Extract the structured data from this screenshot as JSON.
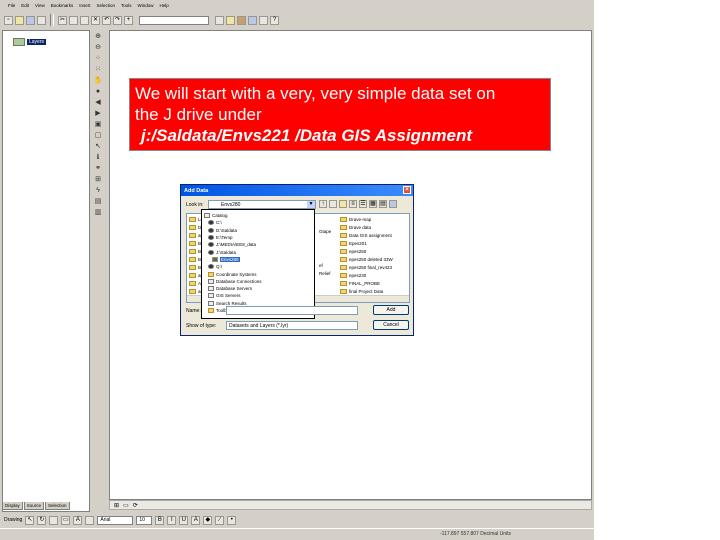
{
  "menu": [
    "File",
    "Edit",
    "View",
    "Bookmarks",
    "Insert",
    "Selection",
    "Tools",
    "Window",
    "Help"
  ],
  "toc": {
    "layer_label": "Layers",
    "tabs": [
      "Display",
      "Source",
      "Selection"
    ]
  },
  "callout": {
    "line1": "We will start with a very, very simple data set on",
    "line2": "the J drive under",
    "line3": "j:/Saldata/Envs221 /Data GIS Assignment"
  },
  "dialog": {
    "title": "Add Data",
    "look_in_label": "Look in:",
    "look_in_value": "Envs280",
    "name_label": "Name:",
    "type_label": "Show of type:",
    "type_value": "Datasets and Layers (*.lyr)",
    "add_button": "Add",
    "cancel_button": "Cancel",
    "list_col1": [
      "Lower",
      "Dr_stee",
      "armo",
      "BO_proje",
      "BO_proje",
      "BO_rus",
      "BO_rivers",
      "amanda",
      "Amanda",
      "amanda"
    ],
    "list_col2": [
      "Gtape",
      "ef",
      "Relief"
    ],
    "list_col3": [
      "Drave-map",
      "Drave data",
      "Data GIS assignment",
      "Epes201",
      "epes250",
      "epes250 deleted 33W",
      "epes250 final_rev423",
      "epes230",
      "FINAL_PROBE",
      "final Project Data"
    ],
    "dropdown": [
      "Catalog",
      "C:\\",
      "D:\\Saldata",
      "E:\\Temp",
      "J:\\MEDIA\\EE8_data",
      "J:\\Saldata",
      "Envs280",
      "Q:\\",
      "Coordinate Systems",
      "Database Connections",
      "Database Servers",
      "GIS Servers",
      "Search Results",
      "Toolboxes"
    ],
    "dropdown_selected": 6
  },
  "drawing": {
    "label": "Drawing",
    "font": "Arial",
    "size": "10"
  },
  "status": {
    "coords": "-117.897 557.807 Decimal Units"
  }
}
